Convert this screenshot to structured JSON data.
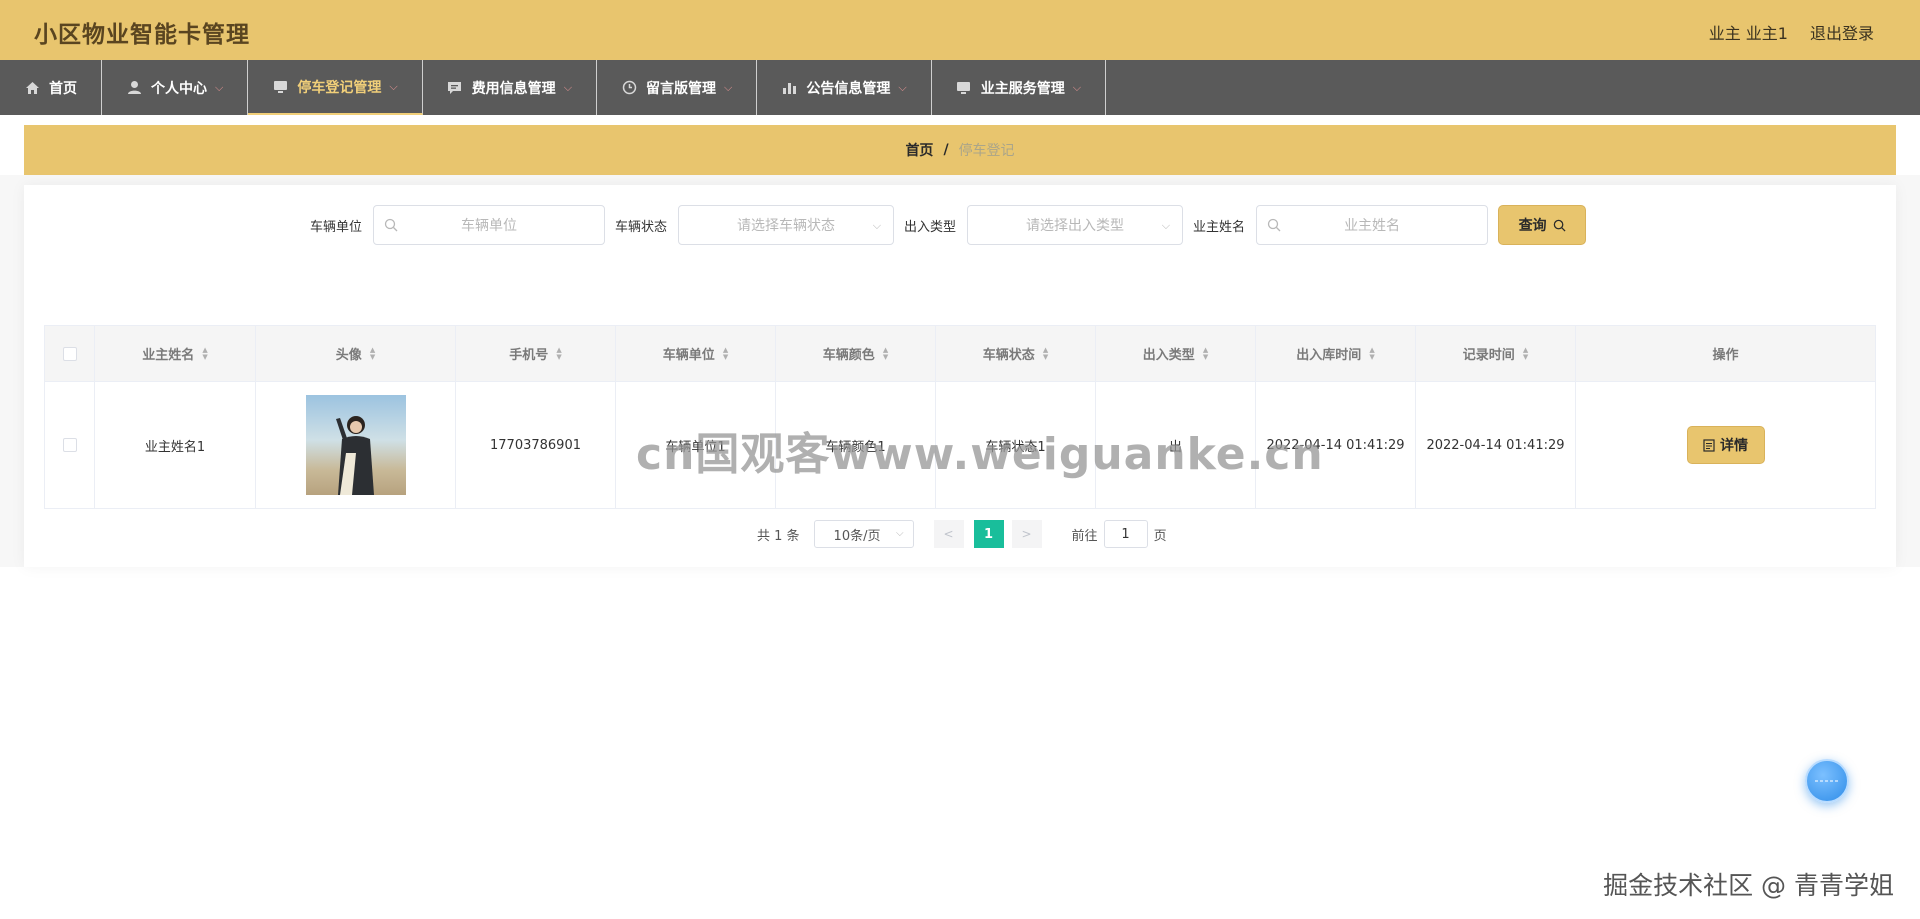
{
  "header": {
    "title": "小区物业智能卡管理",
    "user_label": "业主 业主1",
    "logout": "退出登录"
  },
  "nav": {
    "items": [
      {
        "label": "首页",
        "icon": "home-icon",
        "has_dropdown": false
      },
      {
        "label": "个人中心",
        "icon": "user-icon",
        "has_dropdown": true
      },
      {
        "label": "停车登记管理",
        "icon": "monitor-icon",
        "has_dropdown": true,
        "active": true
      },
      {
        "label": "费用信息管理",
        "icon": "chat-icon",
        "has_dropdown": true
      },
      {
        "label": "留言版管理",
        "icon": "clock-icon",
        "has_dropdown": true
      },
      {
        "label": "公告信息管理",
        "icon": "bar-chart-icon",
        "has_dropdown": true
      },
      {
        "label": "业主服务管理",
        "icon": "monitor-icon",
        "has_dropdown": true
      }
    ],
    "active_color": "#f1cf79"
  },
  "breadcrumb": {
    "home": "首页",
    "separator": "/",
    "current": "停车登记"
  },
  "search": {
    "fields": [
      {
        "label": "车辆单位",
        "placeholder": "车辆单位",
        "type": "input"
      },
      {
        "label": "车辆状态",
        "placeholder": "请选择车辆状态",
        "type": "select"
      },
      {
        "label": "出入类型",
        "placeholder": "请选择出入类型",
        "type": "select"
      },
      {
        "label": "业主姓名",
        "placeholder": "业主姓名",
        "type": "input"
      }
    ],
    "button": "查询"
  },
  "table": {
    "columns": [
      "业主姓名",
      "头像",
      "手机号",
      "车辆单位",
      "车辆颜色",
      "车辆状态",
      "出入类型",
      "出入库时间",
      "记录时间",
      "操作"
    ],
    "rows": [
      {
        "owner_name": "业主姓名1",
        "phone": "17703786901",
        "vehicle_unit": "车辆单位1",
        "vehicle_color": "车辆颜色1",
        "vehicle_status": "车辆状态1",
        "access_type": "出",
        "access_time": "2022-04-14 01:41:29",
        "record_time": "2022-04-14 01:41:29",
        "action": "详情"
      }
    ]
  },
  "pagination": {
    "total": "共 1 条",
    "page_size": "10条/页",
    "current_page": "1",
    "goto_prefix": "前往",
    "goto_value": "1",
    "goto_suffix": "页"
  },
  "watermarks": {
    "center": "cn国观客www.weiguanke.cn",
    "bottom": "掘金技术社区 @ 青青学姐"
  },
  "colors": {
    "brand": "#e8c56e",
    "nav_bg": "#5a5a5a",
    "pager_active": "#19be9b"
  }
}
